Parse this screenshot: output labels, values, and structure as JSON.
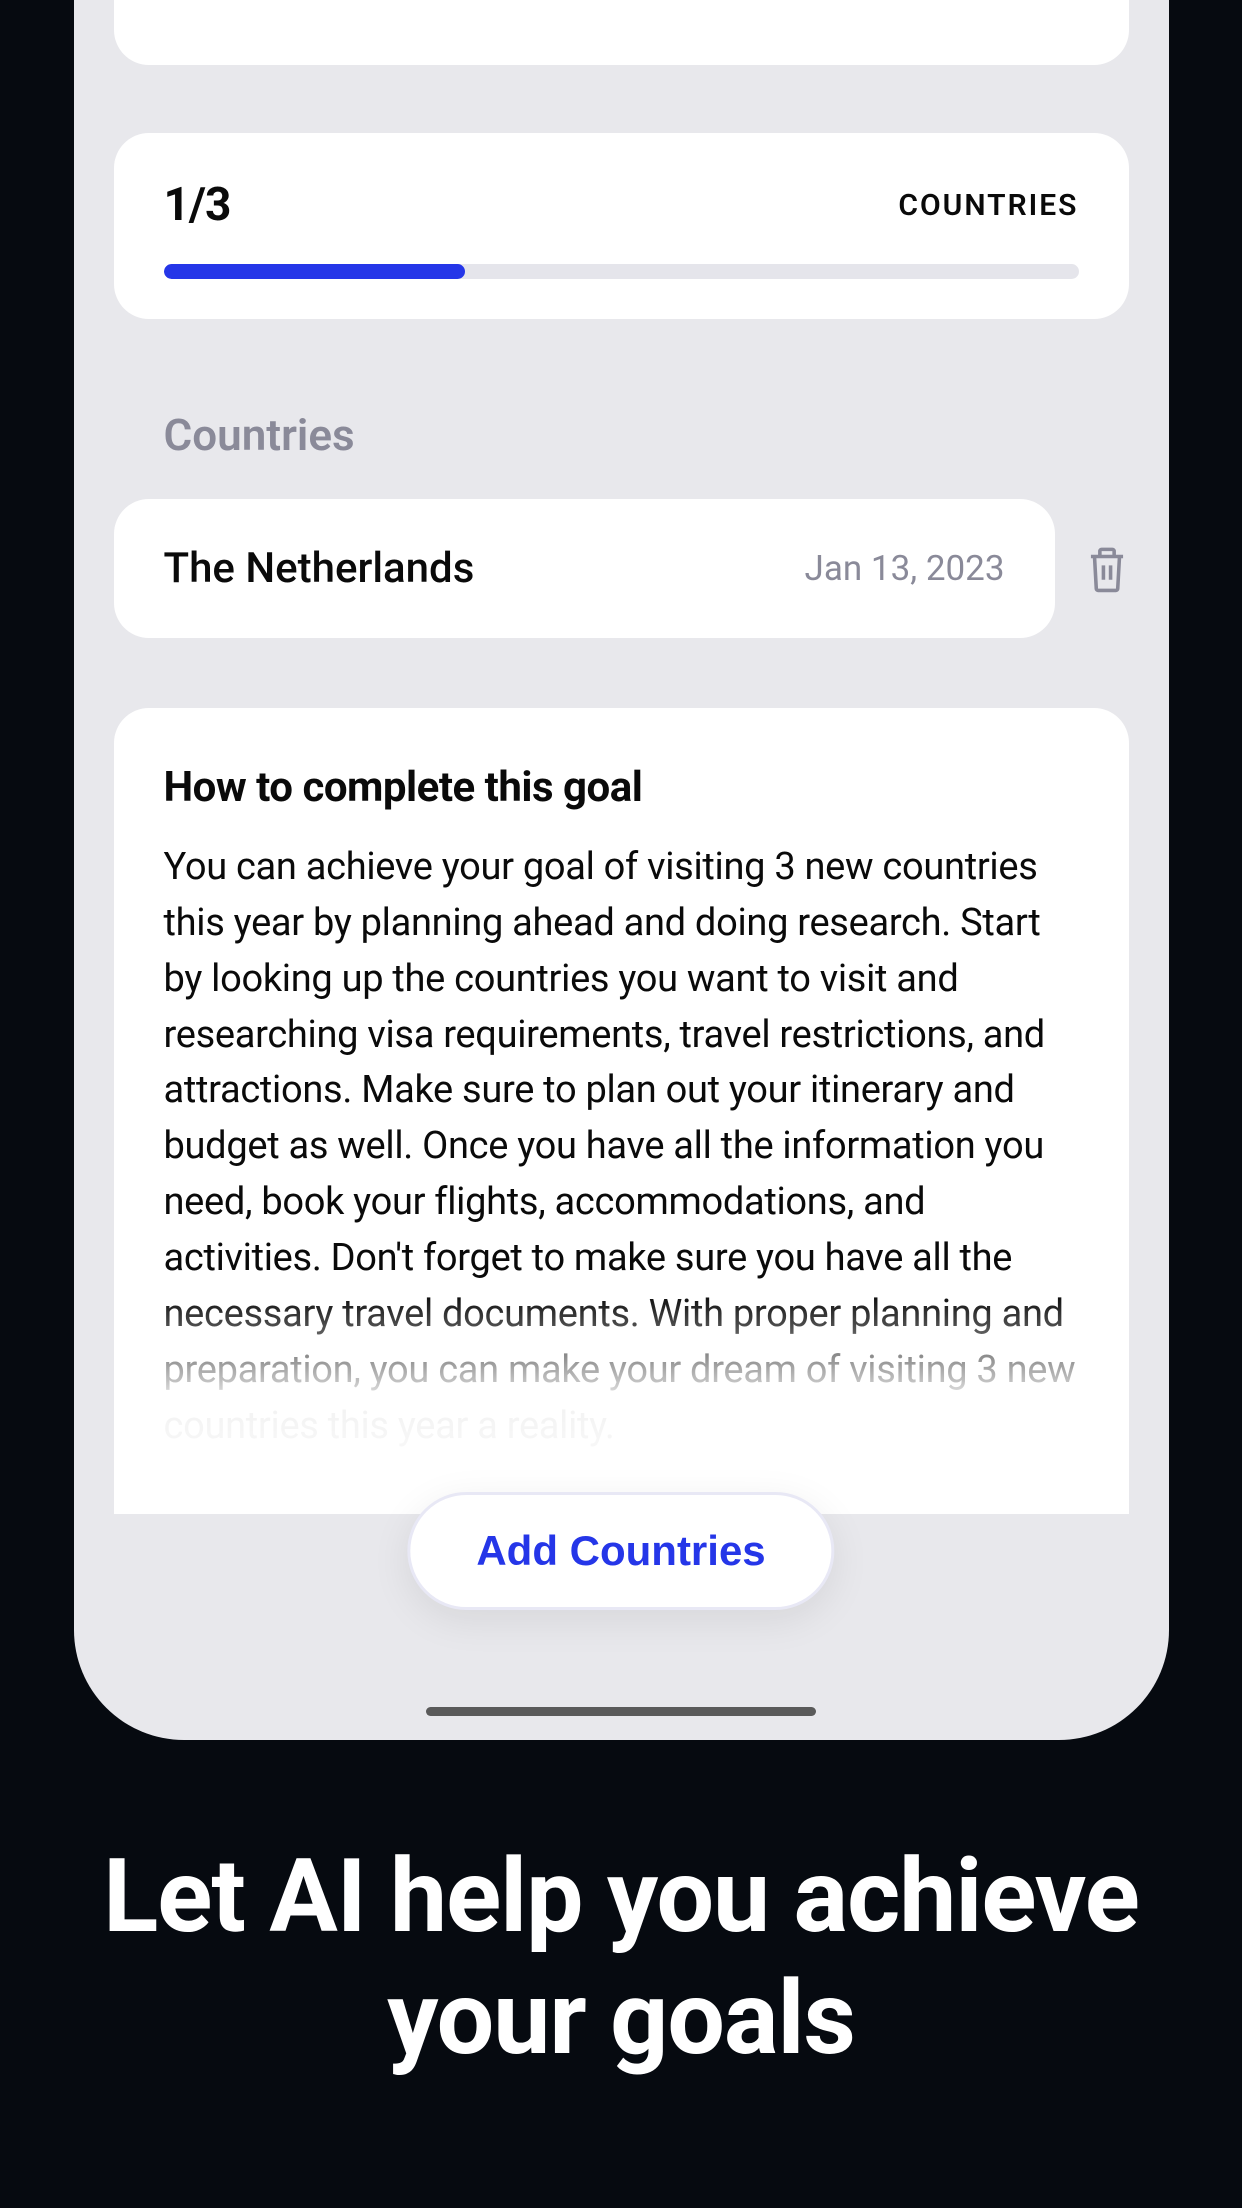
{
  "progress": {
    "count": "1/3",
    "label": "COUNTRIES",
    "percent": 33
  },
  "section": {
    "title": "Countries"
  },
  "countries": [
    {
      "name": "The Netherlands",
      "date": "Jan 13, 2023"
    }
  ],
  "advice": {
    "title": "How to complete this goal",
    "text": "You can achieve your goal of visiting 3 new countries this year by planning ahead and doing research. Start by looking up the countries you want to visit and researching visa requirements, travel restrictions, and attractions. Make sure to plan out your itinerary and budget as well. Once you have all the information you need, book your flights, accommodations, and activities. Don't forget to make sure you have all the necessary travel documents. With proper planning and preparation, you can make your dream of visiting 3 new countries this year a reality."
  },
  "add_button": {
    "label": "Add Countries"
  },
  "marketing": {
    "text": "Let AI help you achieve your goals"
  }
}
